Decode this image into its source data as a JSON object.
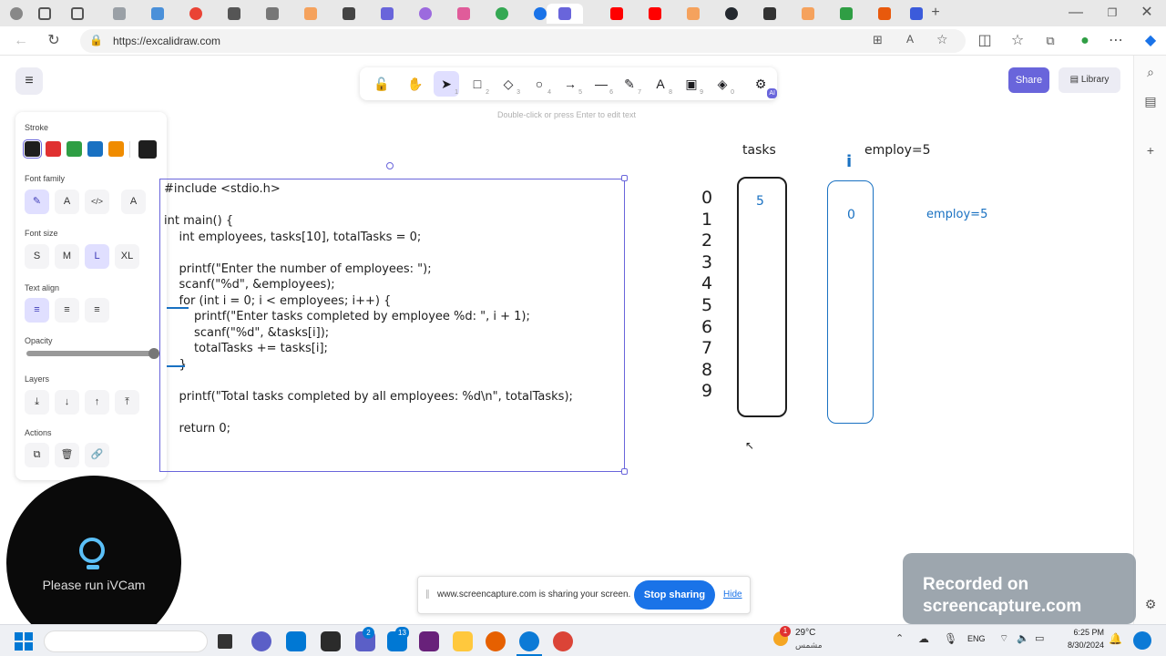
{
  "browser": {
    "url": "https://excalidraw.com"
  },
  "toolbar": {
    "tools": [
      {
        "name": "lock",
        "glyph": "🔓",
        "key": ""
      },
      {
        "name": "hand",
        "glyph": "✋",
        "key": ""
      },
      {
        "name": "selection",
        "glyph": "➤",
        "key": "1"
      },
      {
        "name": "rectangle",
        "glyph": "□",
        "key": "2"
      },
      {
        "name": "diamond",
        "glyph": "◇",
        "key": "3"
      },
      {
        "name": "ellipse",
        "glyph": "○",
        "key": "4"
      },
      {
        "name": "arrow",
        "glyph": "→",
        "key": "5"
      },
      {
        "name": "line",
        "glyph": "—",
        "key": "6"
      },
      {
        "name": "draw",
        "glyph": "✎",
        "key": "7"
      },
      {
        "name": "text",
        "glyph": "A",
        "key": "8"
      },
      {
        "name": "image",
        "glyph": "▣",
        "key": "9"
      },
      {
        "name": "eraser",
        "glyph": "◈",
        "key": "0"
      },
      {
        "name": "ai",
        "glyph": "⚙",
        "key": "AI"
      }
    ],
    "hint": "Double-click or press Enter to edit text",
    "share_label": "Share",
    "library_label": "Library"
  },
  "props": {
    "stroke_label": "Stroke",
    "stroke_colors": [
      "#1e1e1e",
      "#e03131",
      "#2f9e44",
      "#1971c2",
      "#f08c00",
      "#1e1e1e"
    ],
    "font_family_label": "Font family",
    "font_size_label": "Font size",
    "font_sizes": [
      "S",
      "M",
      "L",
      "XL"
    ],
    "text_align_label": "Text align",
    "opacity_label": "Opacity",
    "layers_label": "Layers",
    "actions_label": "Actions"
  },
  "drawing": {
    "code_lines": [
      "#include <stdio.h>",
      "",
      "int main() {",
      "    int employees, tasks[10], totalTasks = 0;",
      "",
      "    printf(\"Enter the number of employees: \");",
      "    scanf(\"%d\", &employees);",
      "    for (int i = 0; i < employees; i++) {",
      "        printf(\"Enter tasks completed by employee %d: \", i + 1);",
      "        scanf(\"%d\", &tasks[i]);",
      "        totalTasks += tasks[i];",
      "    }",
      "",
      "    printf(\"Total tasks completed by all employees: %d\\n\", totalTasks);",
      "",
      "    return 0;"
    ],
    "indices": [
      "0",
      "1",
      "2",
      "3",
      "4",
      "5",
      "6",
      "7",
      "8",
      "9"
    ],
    "tasks_label": "tasks",
    "tasks_value": "5",
    "i_label": "i",
    "employ_label": "employ=5",
    "i_value": "0",
    "employ_blue": "employ=5"
  },
  "ivcam": {
    "text": "Please run iVCam"
  },
  "share_notice": {
    "message": "www.screencapture.com is sharing your screen.",
    "stop_label": "Stop sharing",
    "hide_label": "Hide"
  },
  "recorded": {
    "line1": "Recorded on",
    "line2": "screencapture.com"
  },
  "taskbar": {
    "weather_temp": "29°C",
    "weather_desc": "مشمس",
    "lang": "ENG",
    "time": "6:25 PM",
    "date": "8/30/2024",
    "badge_teams": "2",
    "badge_mail": "13",
    "badge_weather": "1"
  }
}
